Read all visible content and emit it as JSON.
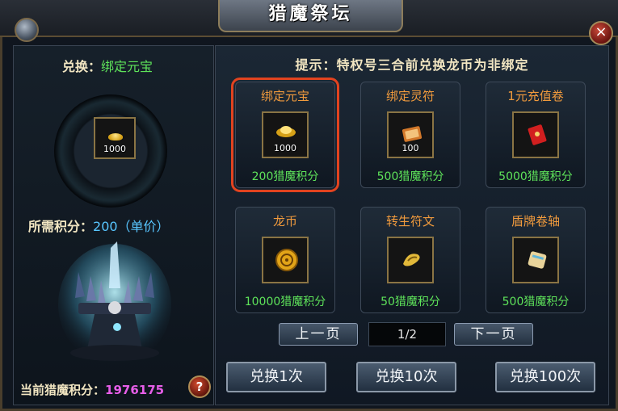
{
  "window": {
    "title": "猎魔祭坛",
    "close_symbol": "×"
  },
  "left": {
    "exchange_prefix": "兑换：",
    "exchange_item": "绑定元宝",
    "selected_count": "1000",
    "need_prefix": "所需积分：",
    "need_value": "200（单价）",
    "current_prefix": "当前猎魔积分：",
    "current_value": "1976175",
    "help_symbol": "?"
  },
  "right": {
    "tip": "提示：特权号三合前兑换龙币为非绑定",
    "items": [
      {
        "name": "绑定元宝",
        "count": "1000",
        "cost": "200猎魔积分",
        "icon": "gold-ingot-icon"
      },
      {
        "name": "绑定灵符",
        "count": "100",
        "cost": "500猎魔积分",
        "icon": "talisman-icon"
      },
      {
        "name": "1元充值卷",
        "count": "",
        "cost": "5000猎魔积分",
        "icon": "red-envelope-icon"
      },
      {
        "name": "龙币",
        "count": "",
        "cost": "10000猎魔积分",
        "icon": "dragon-coin-icon"
      },
      {
        "name": "转生符文",
        "count": "",
        "cost": "50猎魔积分",
        "icon": "rune-icon"
      },
      {
        "name": "盾牌卷轴",
        "count": "",
        "cost": "500猎魔积分",
        "icon": "scroll-icon"
      }
    ],
    "prev_label": "上一页",
    "next_label": "下一页",
    "page": "1/2",
    "exchange_buttons": [
      "兑换1次",
      "兑换10次",
      "兑换100次"
    ]
  },
  "colors": {
    "accent_green": "#5ee35a",
    "accent_orange": "#f09a3d",
    "accent_purple": "#e65ee8",
    "accent_blue": "#58c6ff",
    "selected_border": "#e2431f"
  }
}
